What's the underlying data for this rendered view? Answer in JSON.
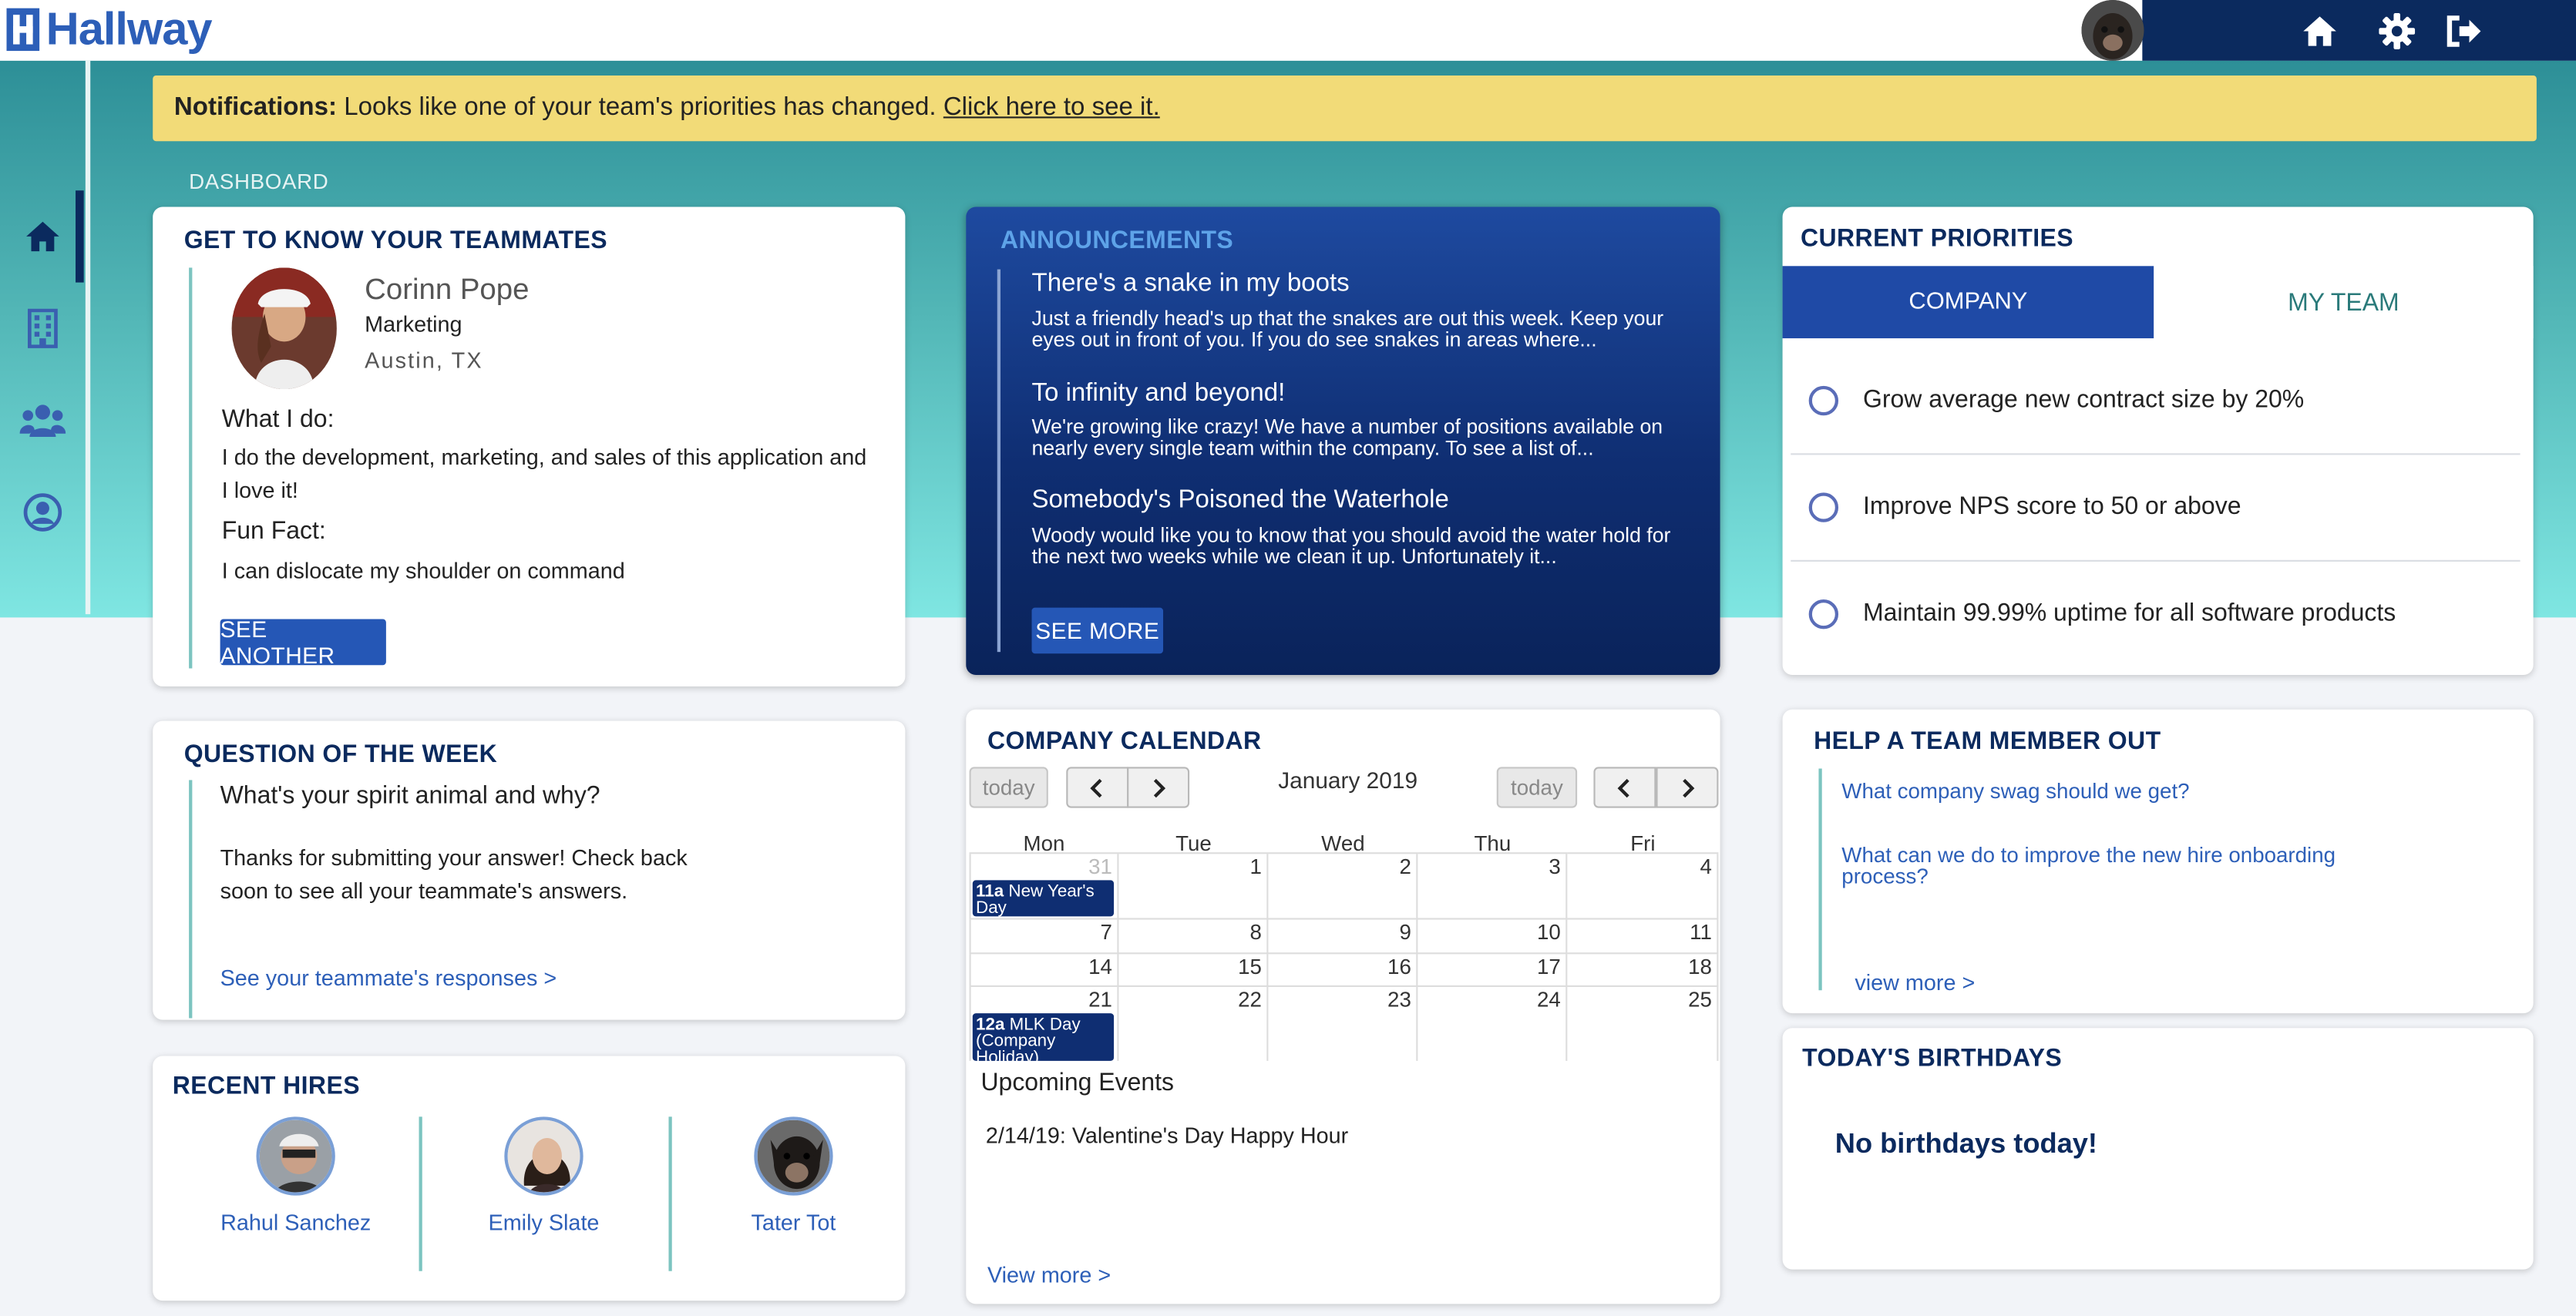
{
  "app": {
    "logo_text": "Hallway"
  },
  "header": {
    "icons": [
      "home-icon",
      "gear-icon",
      "logout-icon"
    ]
  },
  "sidebar": {
    "icons": [
      "home-icon",
      "building-icon",
      "team-icon",
      "profile-icon"
    ]
  },
  "notification": {
    "label": "Notifications:",
    "message": "Looks like one of your team's priorities has changed.",
    "link": "Click here to see it."
  },
  "breadcrumb": "DASHBOARD",
  "teammates": {
    "title": "GET TO KNOW YOUR TEAMMATES",
    "name": "Corinn Pope",
    "department": "Marketing",
    "location": "Austin, TX",
    "what_label": "What I do:",
    "what_text": "I do the development, marketing, and sales of this application and I love it!",
    "fun_label": "Fun Fact:",
    "fun_text": "I can dislocate my shoulder on command",
    "button": "SEE ANOTHER"
  },
  "announcements": {
    "title": "ANNOUNCEMENTS",
    "items": [
      {
        "title": "There's a snake in my boots",
        "body": "Just a friendly head's up that the snakes are out this week. Keep your eyes out in front of you. If you do see snakes in areas where..."
      },
      {
        "title": "To infinity and beyond!",
        "body": "We're growing like crazy! We have a number of positions available on nearly every single team within the company. To see a list of..."
      },
      {
        "title": "Somebody's Poisoned the Waterhole",
        "body": "Woody would like you to know that you should avoid the water hold for the next two weeks while we clean it up. Unfortunately it..."
      }
    ],
    "button": "SEE MORE"
  },
  "priorities": {
    "title": "CURRENT PRIORITIES",
    "tabs": [
      "COMPANY",
      "MY TEAM"
    ],
    "active_tab": "COMPANY",
    "items": [
      "Grow average new contract size by 20%",
      "Improve NPS score to 50 or above",
      "Maintain 99.99% uptime for all software products"
    ]
  },
  "question": {
    "title": "QUESTION OF THE WEEK",
    "question": "What's your spirit animal and why?",
    "message": "Thanks for submitting your answer! Check back soon to see all your teammate's answers.",
    "link": "See your teammate's responses >"
  },
  "calendar": {
    "title": "COMPANY CALENDAR",
    "today_label": "today",
    "month": "January 2019",
    "days": [
      "Mon",
      "Tue",
      "Wed",
      "Thu",
      "Fri"
    ],
    "weeks": [
      [
        "31",
        "1",
        "2",
        "3",
        "4"
      ],
      [
        "7",
        "8",
        "9",
        "10",
        "11"
      ],
      [
        "14",
        "15",
        "16",
        "17",
        "18"
      ],
      [
        "21",
        "22",
        "23",
        "24",
        "25"
      ]
    ],
    "events": [
      {
        "time": "11a",
        "title": "New Year's Day"
      },
      {
        "time": "12a",
        "title": "MLK Day (Company Holiday)"
      }
    ],
    "upcoming_title": "Upcoming Events",
    "upcoming": [
      "2/14/19: Valentine's Day Happy Hour"
    ],
    "view_more": "View more >"
  },
  "help": {
    "title": "HELP A TEAM MEMBER OUT",
    "questions": [
      "What company swag should we get?",
      "What can we do to improve the new hire onboarding process?"
    ],
    "view_more": "view more >"
  },
  "hires": {
    "title": "RECENT HIRES",
    "people": [
      "Rahul Sanchez",
      "Emily Slate",
      "Tater Tot"
    ]
  },
  "birthdays": {
    "title": "TODAY'S BIRTHDAYS",
    "message": "No birthdays today!"
  },
  "colors": {
    "navy": "#0b2a5e",
    "accent_blue": "#2557b6",
    "notification_yellow": "#f2db78",
    "teal": "#52b6b6"
  }
}
